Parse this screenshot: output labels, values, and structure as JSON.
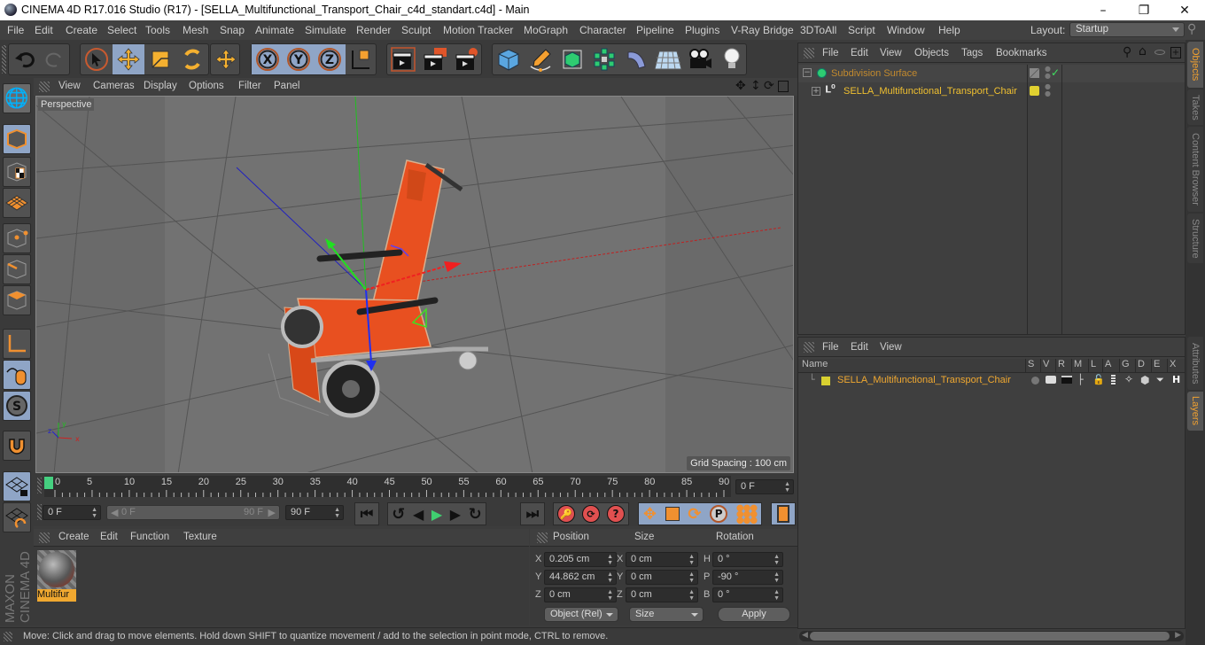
{
  "window": {
    "title": "CINEMA 4D R17.016 Studio (R17) - [SELLA_Multifunctional_Transport_Chair_c4d_standart.c4d] - Main",
    "controls": [
      "minimize",
      "maximize",
      "close"
    ]
  },
  "menubar": {
    "items": [
      "File",
      "Edit",
      "Create",
      "Select",
      "Tools",
      "Mesh",
      "Snap",
      "Animate",
      "Simulate",
      "Render",
      "Sculpt",
      "Motion Tracker",
      "MoGraph",
      "Character",
      "Pipeline",
      "Plugins",
      "V-Ray Bridge",
      "3DToAll",
      "Script",
      "Window",
      "Help"
    ],
    "layout_label": "Layout:",
    "layout_value": "Startup"
  },
  "toolbar": {
    "tools": [
      "undo",
      "redo",
      "live-selection",
      "move",
      "scale",
      "rotate",
      "last-tool",
      "x-axis",
      "y-axis",
      "z-axis",
      "coordinate-system",
      "render-view",
      "render-to-picture-viewer",
      "render-settings",
      "cube",
      "pen",
      "subdivision-surface",
      "cloner",
      "deformer",
      "floor",
      "camera",
      "light"
    ]
  },
  "left_tools": [
    "make-editable",
    "model-mode",
    "texture-mode",
    "workplane-mode",
    "points-mode",
    "edges-mode",
    "polygons-mode",
    "axis-mode",
    "tweak-mode",
    "solo-mode",
    "snapping",
    "workplane-lock",
    "workplane-align"
  ],
  "brand": "MAXON CINEMA 4D",
  "viewport": {
    "menu": [
      "View",
      "Cameras",
      "Display",
      "Options",
      "Filter",
      "Panel"
    ],
    "camera_label": "Perspective",
    "grid_spacing": "Grid Spacing : 100 cm"
  },
  "timeline": {
    "ticks": [
      "0",
      "5",
      "10",
      "15",
      "20",
      "25",
      "30",
      "35",
      "40",
      "45",
      "50",
      "55",
      "60",
      "65",
      "70",
      "75",
      "80",
      "85",
      "90"
    ],
    "current_frame_field": "0 F",
    "start_field": "0 F",
    "range_start": "0 F",
    "range_end": "90 F",
    "end_field": "90 F"
  },
  "material_manager": {
    "menu": [
      "Create",
      "Edit",
      "Function",
      "Texture"
    ],
    "materials": [
      {
        "name": "Multifur"
      }
    ]
  },
  "coordinates": {
    "headers": {
      "position": "Position",
      "size": "Size",
      "rotation": "Rotation"
    },
    "position": [
      {
        "axis": "X",
        "value": "0.205 cm"
      },
      {
        "axis": "Y",
        "value": "44.862 cm"
      },
      {
        "axis": "Z",
        "value": "0 cm"
      }
    ],
    "size": [
      {
        "axis": "X",
        "value": "0 cm"
      },
      {
        "axis": "Y",
        "value": "0 cm"
      },
      {
        "axis": "Z",
        "value": "0 cm"
      }
    ],
    "rotation": [
      {
        "axis": "H",
        "value": "0 °"
      },
      {
        "axis": "P",
        "value": "-90 °"
      },
      {
        "axis": "B",
        "value": "0 °"
      }
    ],
    "mode_select": "Object (Rel)",
    "size_select": "Size",
    "apply_label": "Apply"
  },
  "object_manager": {
    "menu": [
      "File",
      "Edit",
      "View",
      "Objects",
      "Tags",
      "Bookmarks"
    ],
    "objects": [
      {
        "name": "Subdivision Surface",
        "color": "#c28a2e"
      },
      {
        "name": "SELLA_Multifunctional_Transport_Chair",
        "color": "#f0c030"
      }
    ]
  },
  "layer_manager": {
    "menu": [
      "File",
      "Edit",
      "View"
    ],
    "columns": [
      "Name",
      "S",
      "V",
      "R",
      "M",
      "L",
      "A",
      "G",
      "D",
      "E",
      "X"
    ],
    "layers": [
      {
        "name": "SELLA_Multifunctional_Transport_Chair",
        "color": "#d8d030"
      }
    ]
  },
  "side_tabs_top": [
    {
      "label": "Objects",
      "active": true
    },
    {
      "label": "Takes",
      "active": false
    },
    {
      "label": "Content Browser",
      "active": false
    },
    {
      "label": "Structure",
      "active": false
    }
  ],
  "side_tabs_bottom": [
    {
      "label": "Attributes",
      "active": false
    },
    {
      "label": "Layers",
      "active": true
    }
  ],
  "status": "Move: Click and drag to move elements. Hold down SHIFT to quantize movement / add to the selection in point mode, CTRL to remove."
}
